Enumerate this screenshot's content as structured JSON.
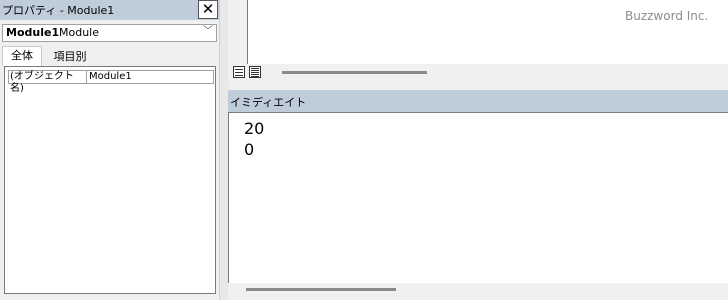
{
  "properties_pane": {
    "title": "プロパティ - Module1",
    "close_label": "✕",
    "object_select": {
      "name": "Module1",
      "type": "Module"
    },
    "tabs": [
      {
        "label": "全体"
      },
      {
        "label": "項目別"
      }
    ],
    "rows": [
      {
        "key": "(オブジェクト名)",
        "value": "Module1"
      }
    ]
  },
  "code_window": {
    "watermark": "Buzzword Inc."
  },
  "immediate_window": {
    "title": "イミディエイト",
    "lines": [
      "20",
      "0"
    ]
  },
  "icons": {
    "close": "close-icon",
    "dropdown": "chevron-down-icon",
    "procedure_view": "procedure-view-icon",
    "full_module_view": "full-module-view-icon"
  },
  "colors": {
    "titlebar": "#bfcddb",
    "panel_bg": "#f0f0f0",
    "watermark": "#8c8c8c"
  }
}
